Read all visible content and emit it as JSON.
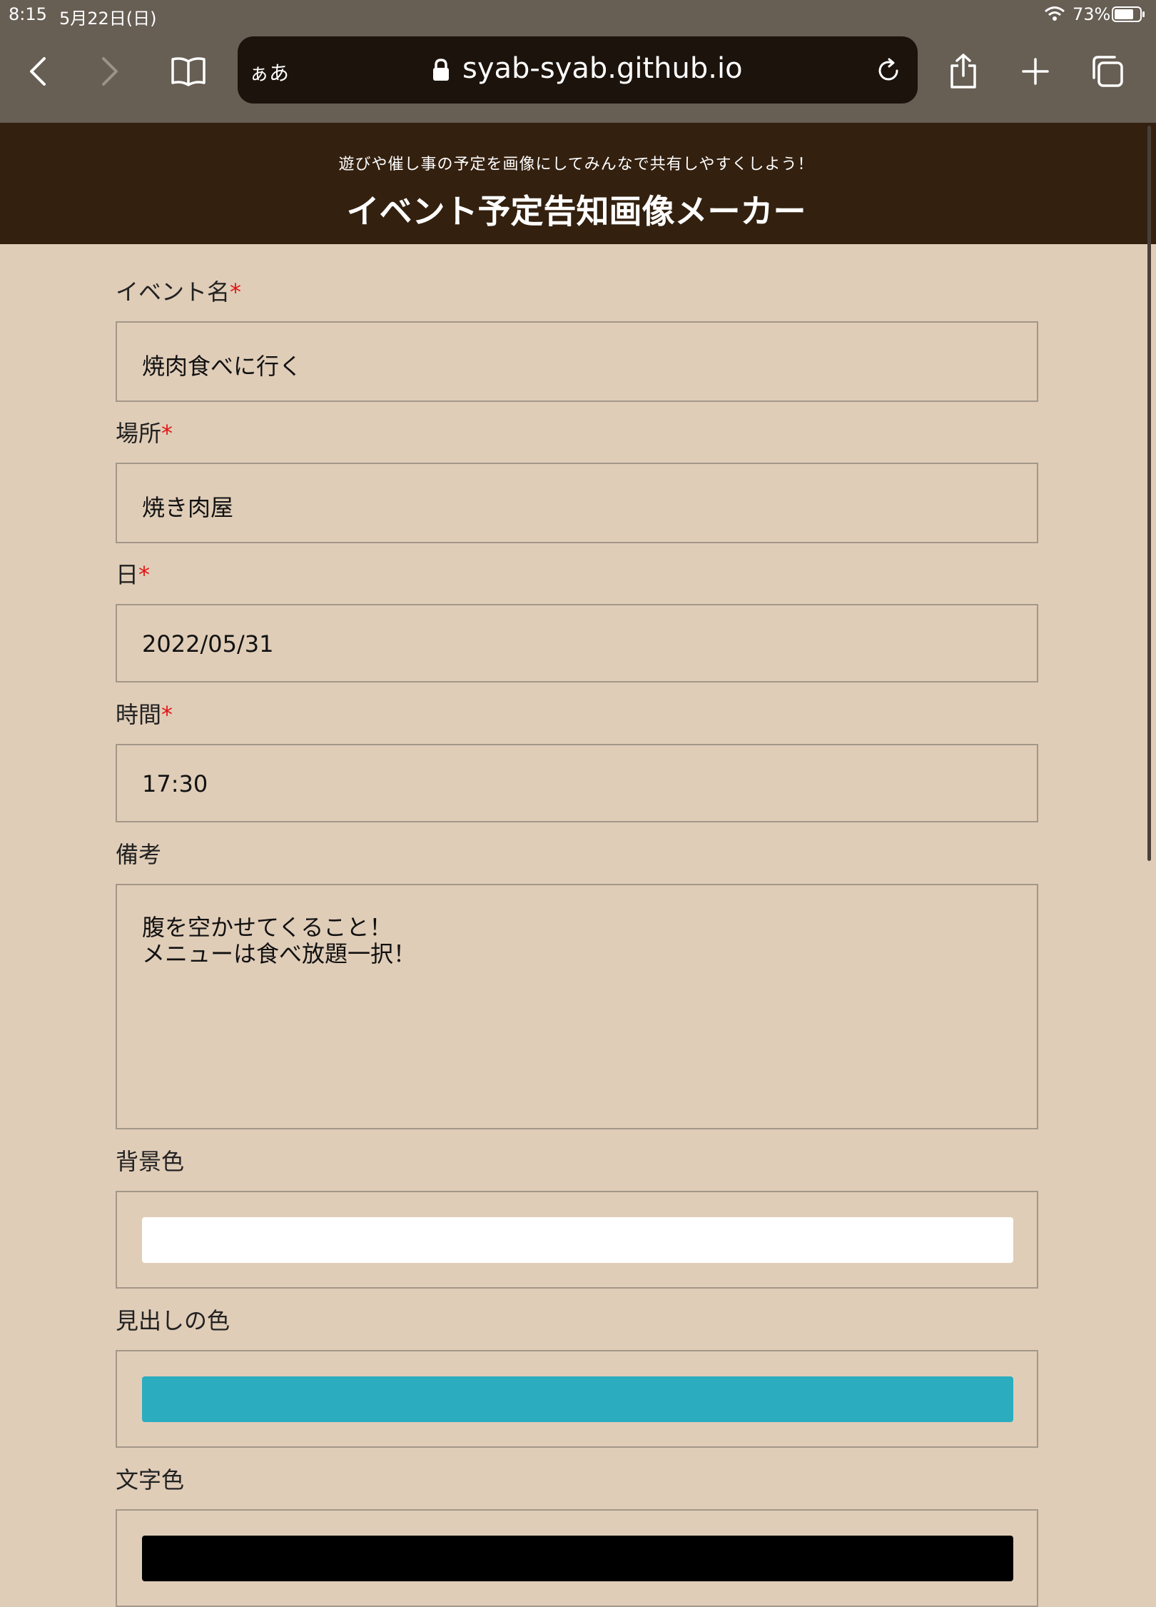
{
  "status_bar": {
    "time": "8:15",
    "date": "5月22日(日)",
    "battery": "73%"
  },
  "browser": {
    "reader_label": "ぁあ",
    "url": "syab-syab.github.io",
    "icons": [
      "chevron-left-icon",
      "chevron-right-icon",
      "book-icon",
      "lock-icon",
      "reload-icon",
      "share-icon",
      "plus-icon",
      "tabs-icon"
    ]
  },
  "header": {
    "subtitle": "遊びや催し事の予定を画像にしてみんなで共有しやすくしよう！",
    "title": "イベント予定告知画像メーカー"
  },
  "form": {
    "event_name": {
      "label": "イベント名",
      "required_mark": "*",
      "value": "焼肉食べに行く"
    },
    "place": {
      "label": "場所",
      "required_mark": "*",
      "value": "焼き肉屋"
    },
    "date": {
      "label": "日",
      "required_mark": "*",
      "value": "2022/05/31"
    },
    "time": {
      "label": "時間",
      "required_mark": "*",
      "value": "17:30"
    },
    "notes": {
      "label": "備考",
      "line1": "腹を空かせてくること！",
      "line2": "メニューは食べ放題一択！"
    },
    "bg_color": {
      "label": "背景色",
      "value": "#ffffff"
    },
    "heading_color": {
      "label": "見出しの色",
      "value": "#2badbf"
    },
    "text_color": {
      "label": "文字色",
      "value": "#000000"
    }
  },
  "colors": {
    "page_bg": "#e0cdb8",
    "header_bg": "#33200f",
    "chrome_bg": "#675e54",
    "required": "#e01818"
  }
}
